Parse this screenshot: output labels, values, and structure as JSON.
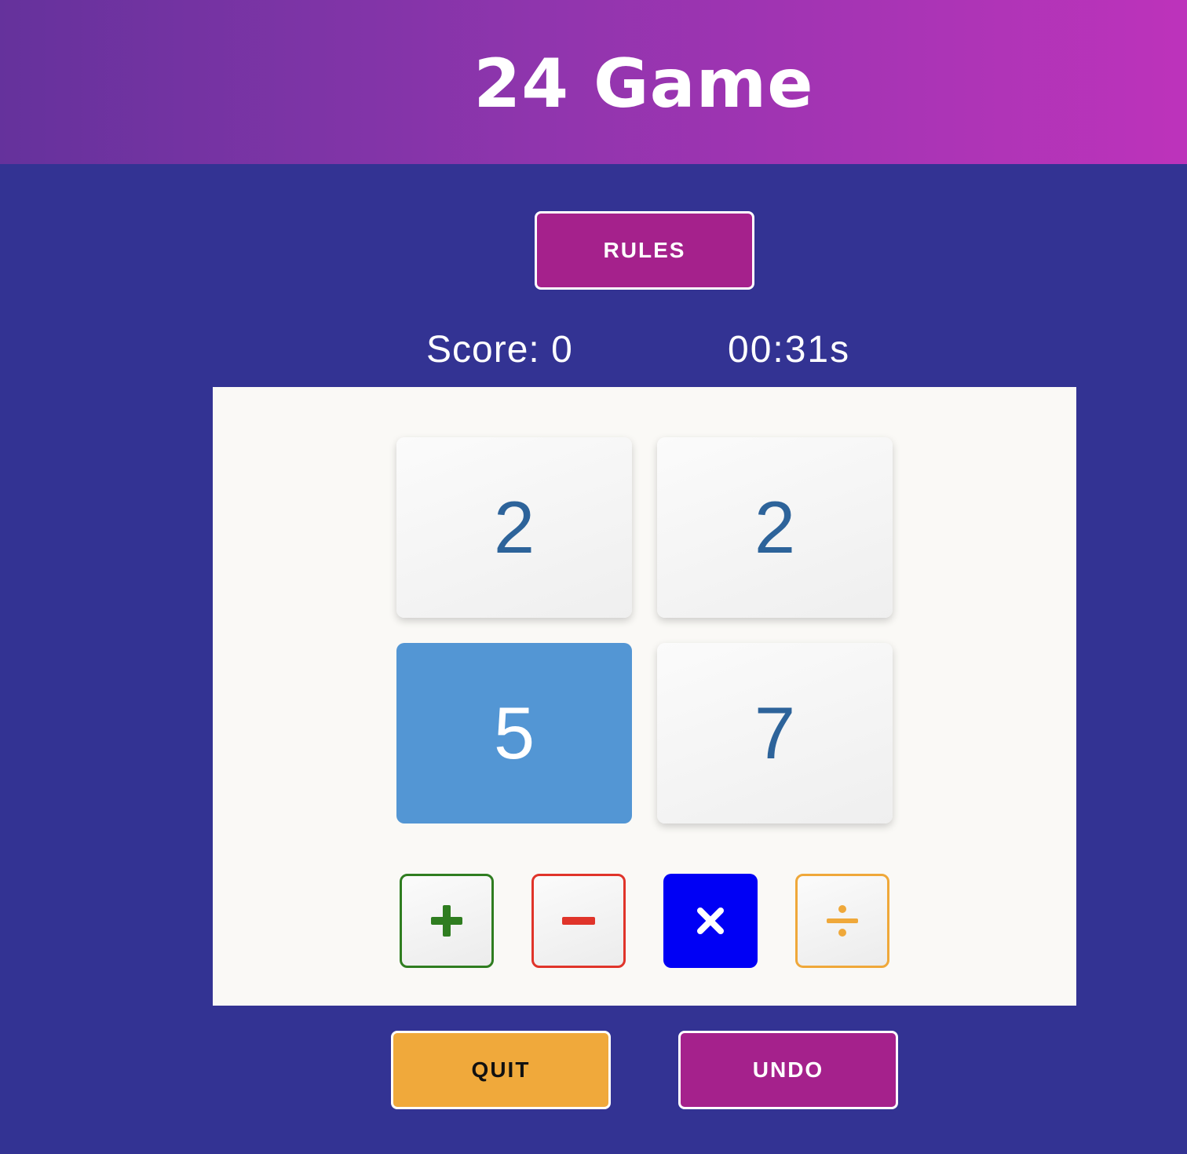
{
  "header": {
    "title": "24 Game"
  },
  "controls": {
    "rules_label": "RULES"
  },
  "status": {
    "score": "Score: 0",
    "timer": "00:31s"
  },
  "cards": [
    {
      "value": "2",
      "selected": false
    },
    {
      "value": "2",
      "selected": false
    },
    {
      "value": "5",
      "selected": true
    },
    {
      "value": "7",
      "selected": false
    }
  ],
  "operators": [
    {
      "symbol": "+",
      "icon": "plus-icon",
      "color": "#2f7d20"
    },
    {
      "symbol": "−",
      "icon": "minus-icon",
      "color": "#e0342a"
    },
    {
      "symbol": "×",
      "icon": "multiply-icon",
      "color": "#ffffff"
    },
    {
      "symbol": "÷",
      "icon": "divide-icon",
      "color": "#efa83a"
    }
  ],
  "actions": {
    "quit_label": "QUIT",
    "undo_label": "UNDO"
  },
  "colors": {
    "background": "#333393",
    "header_gradient_start": "#65329c",
    "header_gradient_end": "#bd33bb",
    "accent_magenta": "#a5218c",
    "accent_orange": "#f0a93b",
    "card_selected": "#5396d4",
    "card_number": "#2d639a",
    "multiply_bg": "#0000f5"
  }
}
